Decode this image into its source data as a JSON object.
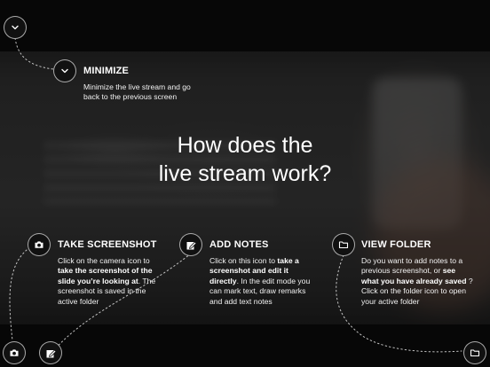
{
  "title": {
    "line1": "How does the",
    "line2": "live stream work?"
  },
  "minimize": {
    "heading": "MINIMIZE",
    "desc": "Minimize the live stream and go back to the previous screen",
    "icon": "chevron-down-icon"
  },
  "screenshot": {
    "heading": "TAKE SCREENSHOT",
    "desc_1": "Click on the camera icon to ",
    "desc_bold": "take the screenshot of the slide you’re looking at",
    "desc_2": ". The screenshot is saved in the active folder",
    "icon": "camera-icon"
  },
  "notes": {
    "heading": "ADD NOTES",
    "desc_1": "Click on this icon to ",
    "desc_bold": "take a screenshot and edit it directly",
    "desc_2": ". In the edit mode you can mark text, draw remarks and add text notes",
    "icon": "pencil-note-icon"
  },
  "folder": {
    "heading": "VIEW FOLDER",
    "desc_1": "Do you want to add notes to a previous screenshot, or ",
    "desc_bold": "see what you have already saved",
    "desc_2": " ?  Click on the folder icon to open your active folder",
    "icon": "folder-icon"
  },
  "colors": {
    "bar": "#0d0d0d",
    "button_bg": "#111111",
    "text": "#ffffff"
  }
}
